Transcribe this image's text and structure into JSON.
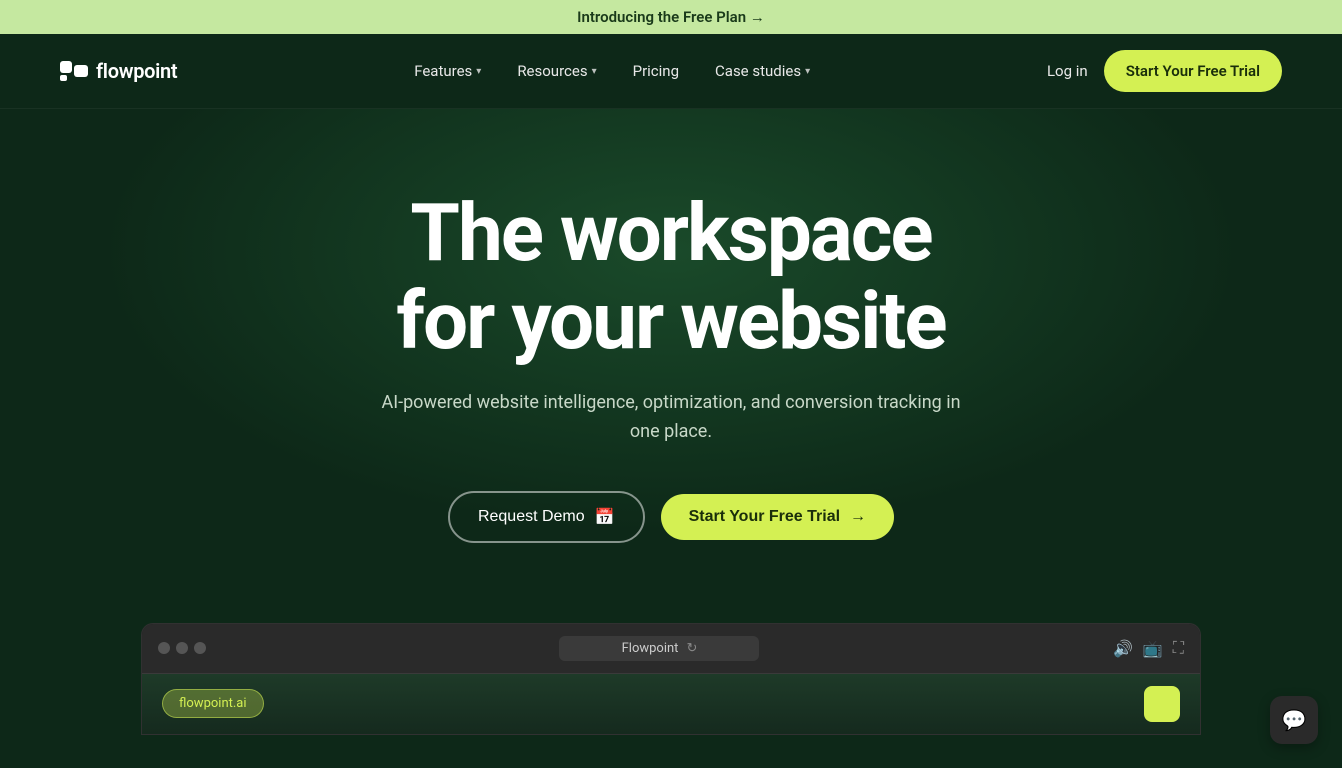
{
  "announcement": {
    "text": "Introducing the Free Plan →"
  },
  "navbar": {
    "logo_text": "flowpoint",
    "nav_items": [
      {
        "label": "Features",
        "has_dropdown": true
      },
      {
        "label": "Resources",
        "has_dropdown": true
      },
      {
        "label": "Pricing",
        "has_dropdown": false
      },
      {
        "label": "Case studies",
        "has_dropdown": true
      }
    ],
    "login_label": "Log in",
    "cta_label": "Start Your Free Trial"
  },
  "hero": {
    "title_line1": "The workspace",
    "title_line2": "for your website",
    "subtitle": "AI-powered website intelligence, optimization, and conversion tracking in one place.",
    "btn_demo": "Request Demo",
    "btn_trial": "Start Your Free Trial"
  },
  "browser": {
    "url_text": "Flowpoint",
    "content_pill": "flowpoint.ai"
  },
  "colors": {
    "accent": "#d4f053",
    "bg_dark": "#0d2818",
    "announcement_bg": "#c5e8a0"
  }
}
